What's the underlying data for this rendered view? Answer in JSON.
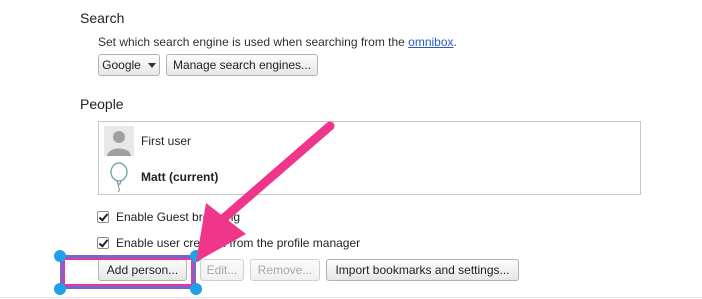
{
  "search": {
    "title": "Search",
    "description_prefix": "Set which search engine is used when searching from the ",
    "omnibox_link": "omnibox",
    "description_suffix": ".",
    "engine_select_value": "Google",
    "manage_button": "Manage search engines..."
  },
  "people": {
    "title": "People",
    "users": [
      {
        "name": "First user",
        "current": false,
        "icon": "generic-avatar-icon"
      },
      {
        "name": "Matt (current)",
        "current": true,
        "icon": "balloon-avatar-icon"
      }
    ],
    "guest_checkbox_label": "Enable Guest browsing",
    "profile_manager_checkbox_label": "Enable user creation from the profile manager",
    "buttons": {
      "add": "Add person...",
      "edit": "Edit...",
      "remove": "Remove...",
      "import": "Import bookmarks and settings..."
    }
  },
  "annotation": {
    "arrow_color": "#f0368a",
    "box_color": "#6b6bd8",
    "handle_color": "#1ea1e8"
  }
}
